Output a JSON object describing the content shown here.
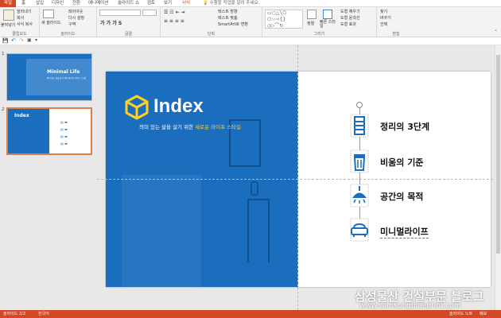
{
  "tabs": [
    "파일",
    "홈",
    "삽입",
    "디자인",
    "전환",
    "애니메이션",
    "슬라이드 쇼",
    "검토",
    "보기",
    "서식"
  ],
  "tell_me": "수행할 작업을 알려 주세요.",
  "ribbon": {
    "clipboard": {
      "label": "클립보드",
      "paste": "붙여넣기",
      "cut": "잘라내기",
      "copy": "복사",
      "format": "서식 복사"
    },
    "slides": {
      "label": "슬라이드",
      "new": "새 슬라이드",
      "layout": "레이아웃",
      "reset": "다시 설정",
      "section": "구역"
    },
    "font": {
      "label": "글꼴"
    },
    "paragraph": {
      "label": "단락",
      "text_dir": "텍스트 방향",
      "align_text": "텍스트 맞춤",
      "smartart": "SmartArt로 변환"
    },
    "drawing": {
      "label": "그리기",
      "arrange": "정렬",
      "quick_styles": "빠른 스타일",
      "fill": "도형 채우기",
      "outline": "도형 윤곽선",
      "effects": "도형 효과"
    },
    "editing": {
      "label": "편집",
      "find": "찾기",
      "replace": "바꾸기",
      "select": "선택"
    }
  },
  "thumbnails": [
    {
      "num": "1",
      "title": "Minimal Life",
      "subtitle": "의미 있는 삶을 살기 위한 새로운 라이프 스타일"
    },
    {
      "num": "2",
      "title": "Index"
    }
  ],
  "slide": {
    "title": "Index",
    "subtitle_pre": "의미 있는 삶을 살기 위한 ",
    "subtitle_highlight": "새로운 라이프 스타일",
    "items": [
      "정리의 3단계",
      "비움의 기준",
      "공간의 목적",
      "미니멀라이프"
    ]
  },
  "status": {
    "slide": "슬라이드 2/2",
    "lang": "한국어",
    "notes": "슬라이드 노트",
    "memo": "메모"
  },
  "watermark": {
    "line1": "삼성물산 건설부문 블로그",
    "line2": "www.samsungblueprint.com"
  },
  "colors": {
    "accent": "#d24726",
    "slide_blue": "#1b6ebe",
    "highlight": "#ffd21f"
  }
}
